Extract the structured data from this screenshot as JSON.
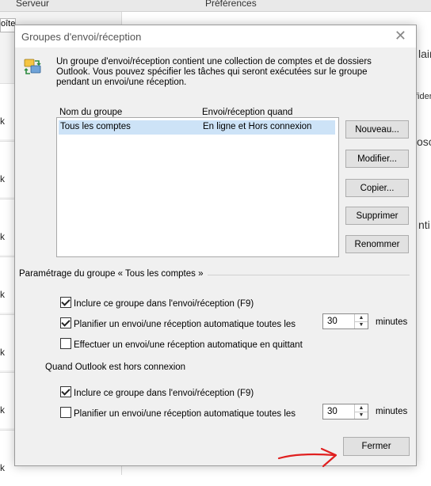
{
  "background": {
    "tabs": [
      "Serveur",
      "Préférences"
    ],
    "top_box_text": "oîte",
    "row_letter": "k",
    "right_snippets": [
      "lair",
      "fider",
      "osc",
      "nti"
    ]
  },
  "dialog": {
    "title": "Groupes d'envoi/réception",
    "close_glyph": "✕",
    "info_text": "Un groupe d'envoi/réception contient une collection de comptes et de dossiers Outlook. Vous pouvez spécifier les tâches qui seront exécutées sur le groupe pendant un envoi/une réception.",
    "columns": [
      "Nom du groupe",
      "Envoi/réception quand"
    ],
    "rows": [
      {
        "name": "Tous les comptes",
        "when": "En ligne et Hors connexion"
      }
    ],
    "buttons": {
      "new": "Nouveau...",
      "edit": "Modifier...",
      "copy": "Copier...",
      "delete": "Supprimer",
      "rename": "Renommer",
      "close": "Fermer"
    },
    "group_settings_label": "Paramétrage du groupe « Tous les comptes »",
    "online": {
      "include_label": "Inclure ce groupe dans l'envoi/réception (F9)",
      "include_checked": true,
      "schedule_label": "Planifier un envoi/une réception automatique toutes les",
      "schedule_checked": true,
      "schedule_value": "30",
      "minutes_label": "minutes",
      "exit_label": "Effectuer un envoi/une réception automatique en quittant",
      "exit_checked": false
    },
    "offline_label": "Quand Outlook est hors connexion",
    "offline": {
      "include_label": "Inclure ce groupe dans l'envoi/réception (F9)",
      "include_checked": true,
      "schedule_label": "Planifier un envoi/une réception automatique toutes les",
      "schedule_checked": false,
      "schedule_value": "30",
      "minutes_label": "minutes"
    }
  },
  "icons": {
    "info": "send-receive-groups-icon",
    "annotation": "red-arrow-icon"
  },
  "colors": {
    "selection": "#cde3f7",
    "annotation": "#e02020"
  }
}
